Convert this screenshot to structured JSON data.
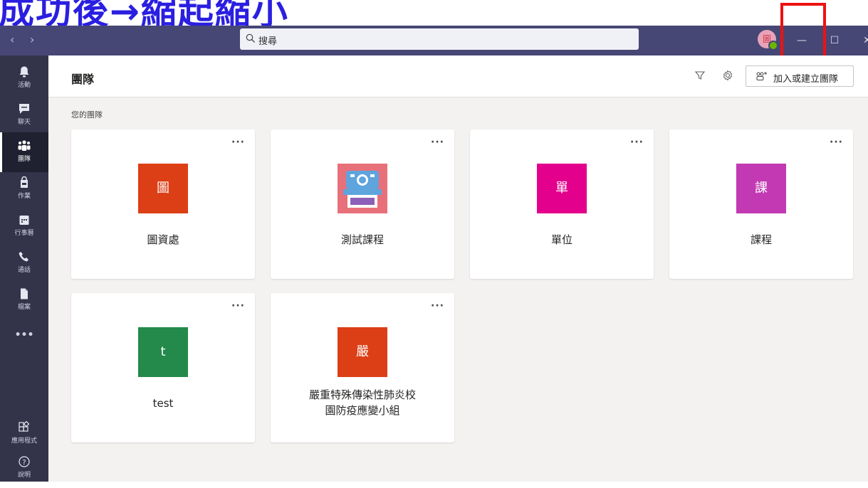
{
  "banner": {
    "text": "成功後→縮起縮小"
  },
  "titlebar": {
    "back_icon": "chevron-left-icon",
    "forward_icon": "chevron-right-icon",
    "search_placeholder": "搜尋",
    "avatar_text": "圖",
    "window_controls": {
      "minimize": "—",
      "maximize": "☐",
      "close": "✕"
    }
  },
  "rail": {
    "items": [
      {
        "label": "活動",
        "icon": "bell-icon"
      },
      {
        "label": "聊天",
        "icon": "chat-icon"
      },
      {
        "label": "團隊",
        "icon": "teams-icon",
        "active": true
      },
      {
        "label": "作業",
        "icon": "assignments-icon"
      },
      {
        "label": "行事曆",
        "icon": "calendar-icon"
      },
      {
        "label": "通話",
        "icon": "phone-icon"
      },
      {
        "label": "檔案",
        "icon": "file-icon"
      }
    ],
    "more": "•••",
    "apps_label": "應用程式",
    "help_label": "說明"
  },
  "header": {
    "title": "團隊",
    "join_button": "加入或建立團隊"
  },
  "section_label": "您的團隊",
  "teams": [
    {
      "name": "圖資處",
      "tile_text": "圖",
      "color": "#dc3e15"
    },
    {
      "name": "測試課程",
      "tile_text": "",
      "color": "#e8707a",
      "image": true
    },
    {
      "name": "單位",
      "tile_text": "單",
      "color": "#e3008c"
    },
    {
      "name": "課程",
      "tile_text": "課",
      "color": "#c239b3"
    },
    {
      "name": "test",
      "tile_text": "t",
      "color": "#238a4b"
    },
    {
      "name": "嚴重特殊傳染性肺炎校園防疫應變小組",
      "tile_text": "嚴",
      "color": "#dc3e15"
    }
  ],
  "card_more": "···"
}
